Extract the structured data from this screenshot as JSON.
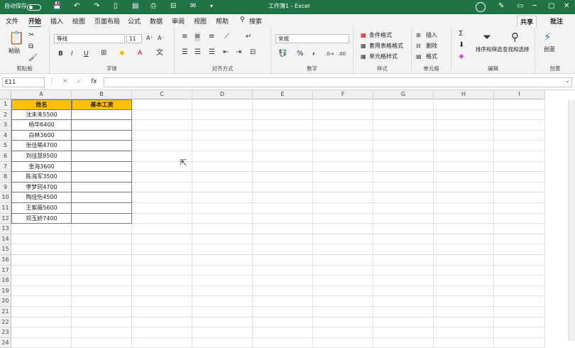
{
  "titlebar": {
    "autosave_label": "自动保存",
    "toggle_state": "关",
    "title": "工作簿1 - Excel"
  },
  "menu": {
    "items": [
      "文件",
      "开始",
      "插入",
      "绘图",
      "页面布局",
      "公式",
      "数据",
      "审阅",
      "视图",
      "帮助"
    ],
    "search": "搜索",
    "share": "共享",
    "comment": "批注"
  },
  "ribbon": {
    "clipboard": {
      "paste": "粘贴",
      "label": "剪贴板"
    },
    "font": {
      "name": "等线",
      "size": "11",
      "label": "字体",
      "bold": "B",
      "italic": "I",
      "underline": "U"
    },
    "align": {
      "label": "对齐方式"
    },
    "number": {
      "format": "常规",
      "label": "数字",
      "percent": "%",
      "comma": ","
    },
    "styles": {
      "cond": "条件格式",
      "table": "套用表格格式",
      "cell": "单元格样式",
      "label": "样式"
    },
    "cells": {
      "insert": "插入",
      "delete": "删除",
      "format": "格式",
      "label": "单元格"
    },
    "editing": {
      "sortfilter": "排序和筛选",
      "findselect": "查找和选择",
      "label": "编辑"
    },
    "create": {
      "btn": "创意",
      "label": "创意"
    }
  },
  "formula": {
    "namebox": "E11",
    "cancel": "✕",
    "enter": "✓",
    "fx": "fx",
    "value": ""
  },
  "sheet": {
    "columns": [
      "A",
      "B",
      "C",
      "D",
      "E",
      "F",
      "G",
      "H",
      "I"
    ],
    "rows": [
      "1",
      "2",
      "3",
      "4",
      "5",
      "6",
      "7",
      "8",
      "9",
      "10",
      "11",
      "12",
      "13",
      "14",
      "15",
      "16",
      "17",
      "18",
      "19",
      "20",
      "21",
      "22",
      "23",
      "24"
    ],
    "headers": [
      "姓名",
      "基本工资"
    ],
    "names": [
      "沈未未5500",
      "杨华6400",
      "白林3600",
      "张佳萌4700",
      "刘佳慧8500",
      "金海3600",
      "陈海军3500",
      "李梦珂4700",
      "陶佳怡4500",
      "王紫薇5600",
      "邓玉娇7400"
    ],
    "header_color": "#ffc000",
    "accent": "#217346"
  }
}
